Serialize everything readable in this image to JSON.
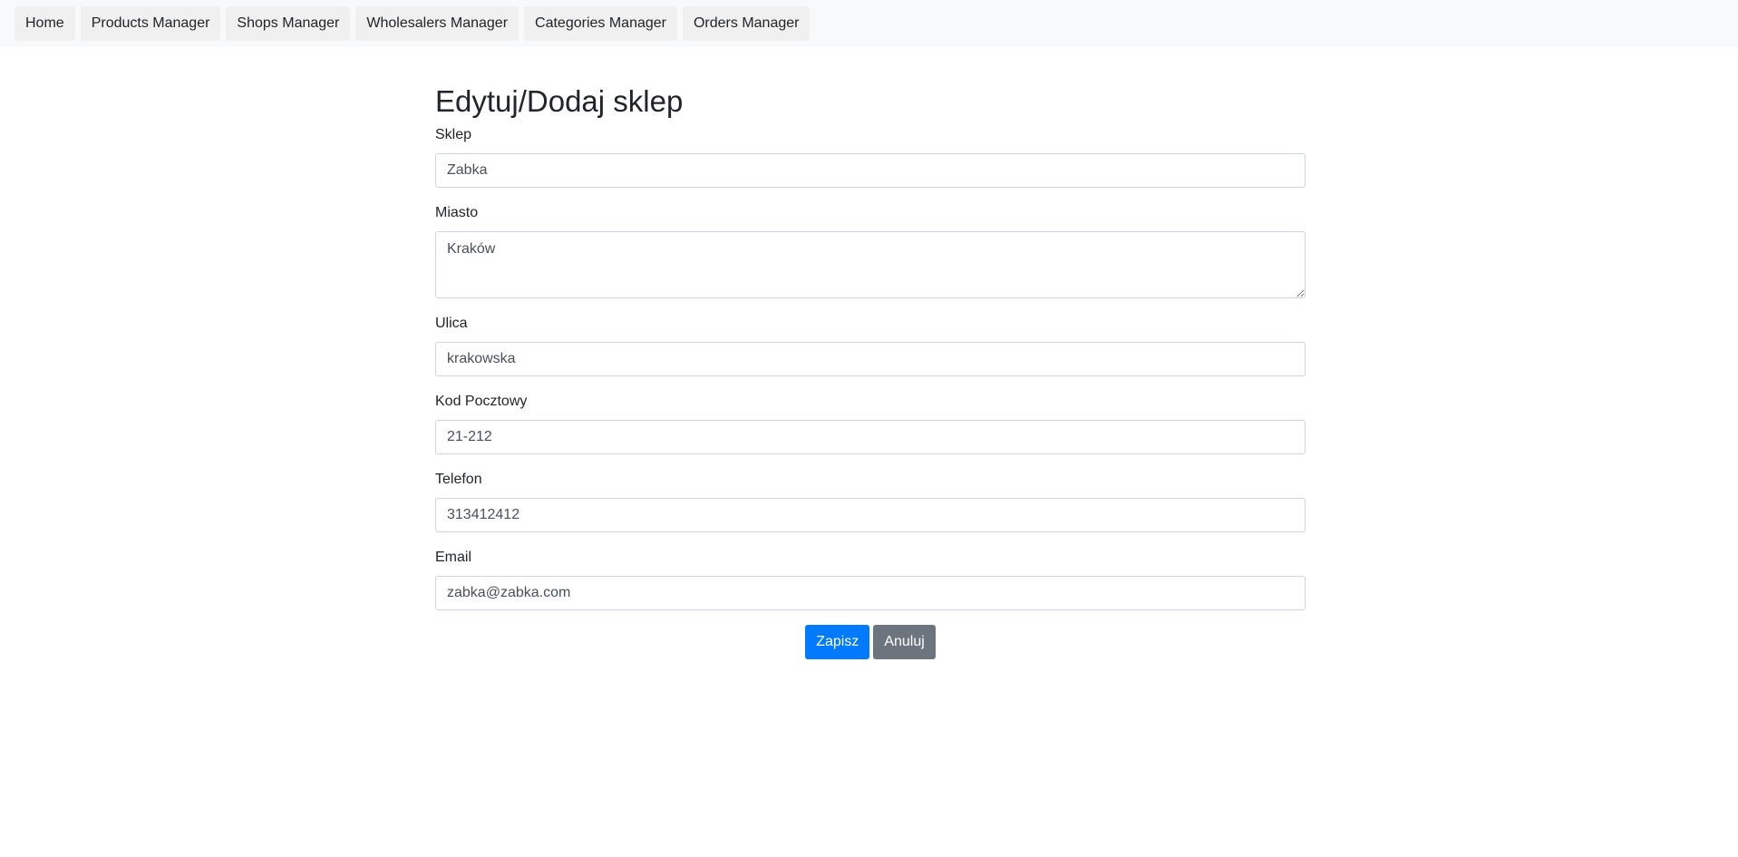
{
  "nav": {
    "items": [
      {
        "label": "Home"
      },
      {
        "label": "Products Manager"
      },
      {
        "label": "Shops Manager"
      },
      {
        "label": "Wholesalers Manager"
      },
      {
        "label": "Categories Manager"
      },
      {
        "label": "Orders Manager"
      }
    ]
  },
  "form": {
    "title": "Edytuj/Dodaj sklep",
    "shop": {
      "label": "Sklep",
      "value": "Zabka"
    },
    "city": {
      "label": "Miasto",
      "value": "Kraków"
    },
    "street": {
      "label": "Ulica",
      "value": "krakowska"
    },
    "postal": {
      "label": "Kod Pocztowy",
      "value": "21-212"
    },
    "phone": {
      "label": "Telefon",
      "value": "313412412"
    },
    "email": {
      "label": "Email",
      "value": "zabka@zabka.com"
    },
    "save_label": "Zapisz",
    "cancel_label": "Anuluj"
  },
  "colors": {
    "navbar_bg": "#f8f9fa",
    "primary": "#007bff",
    "secondary": "#6c757d"
  }
}
